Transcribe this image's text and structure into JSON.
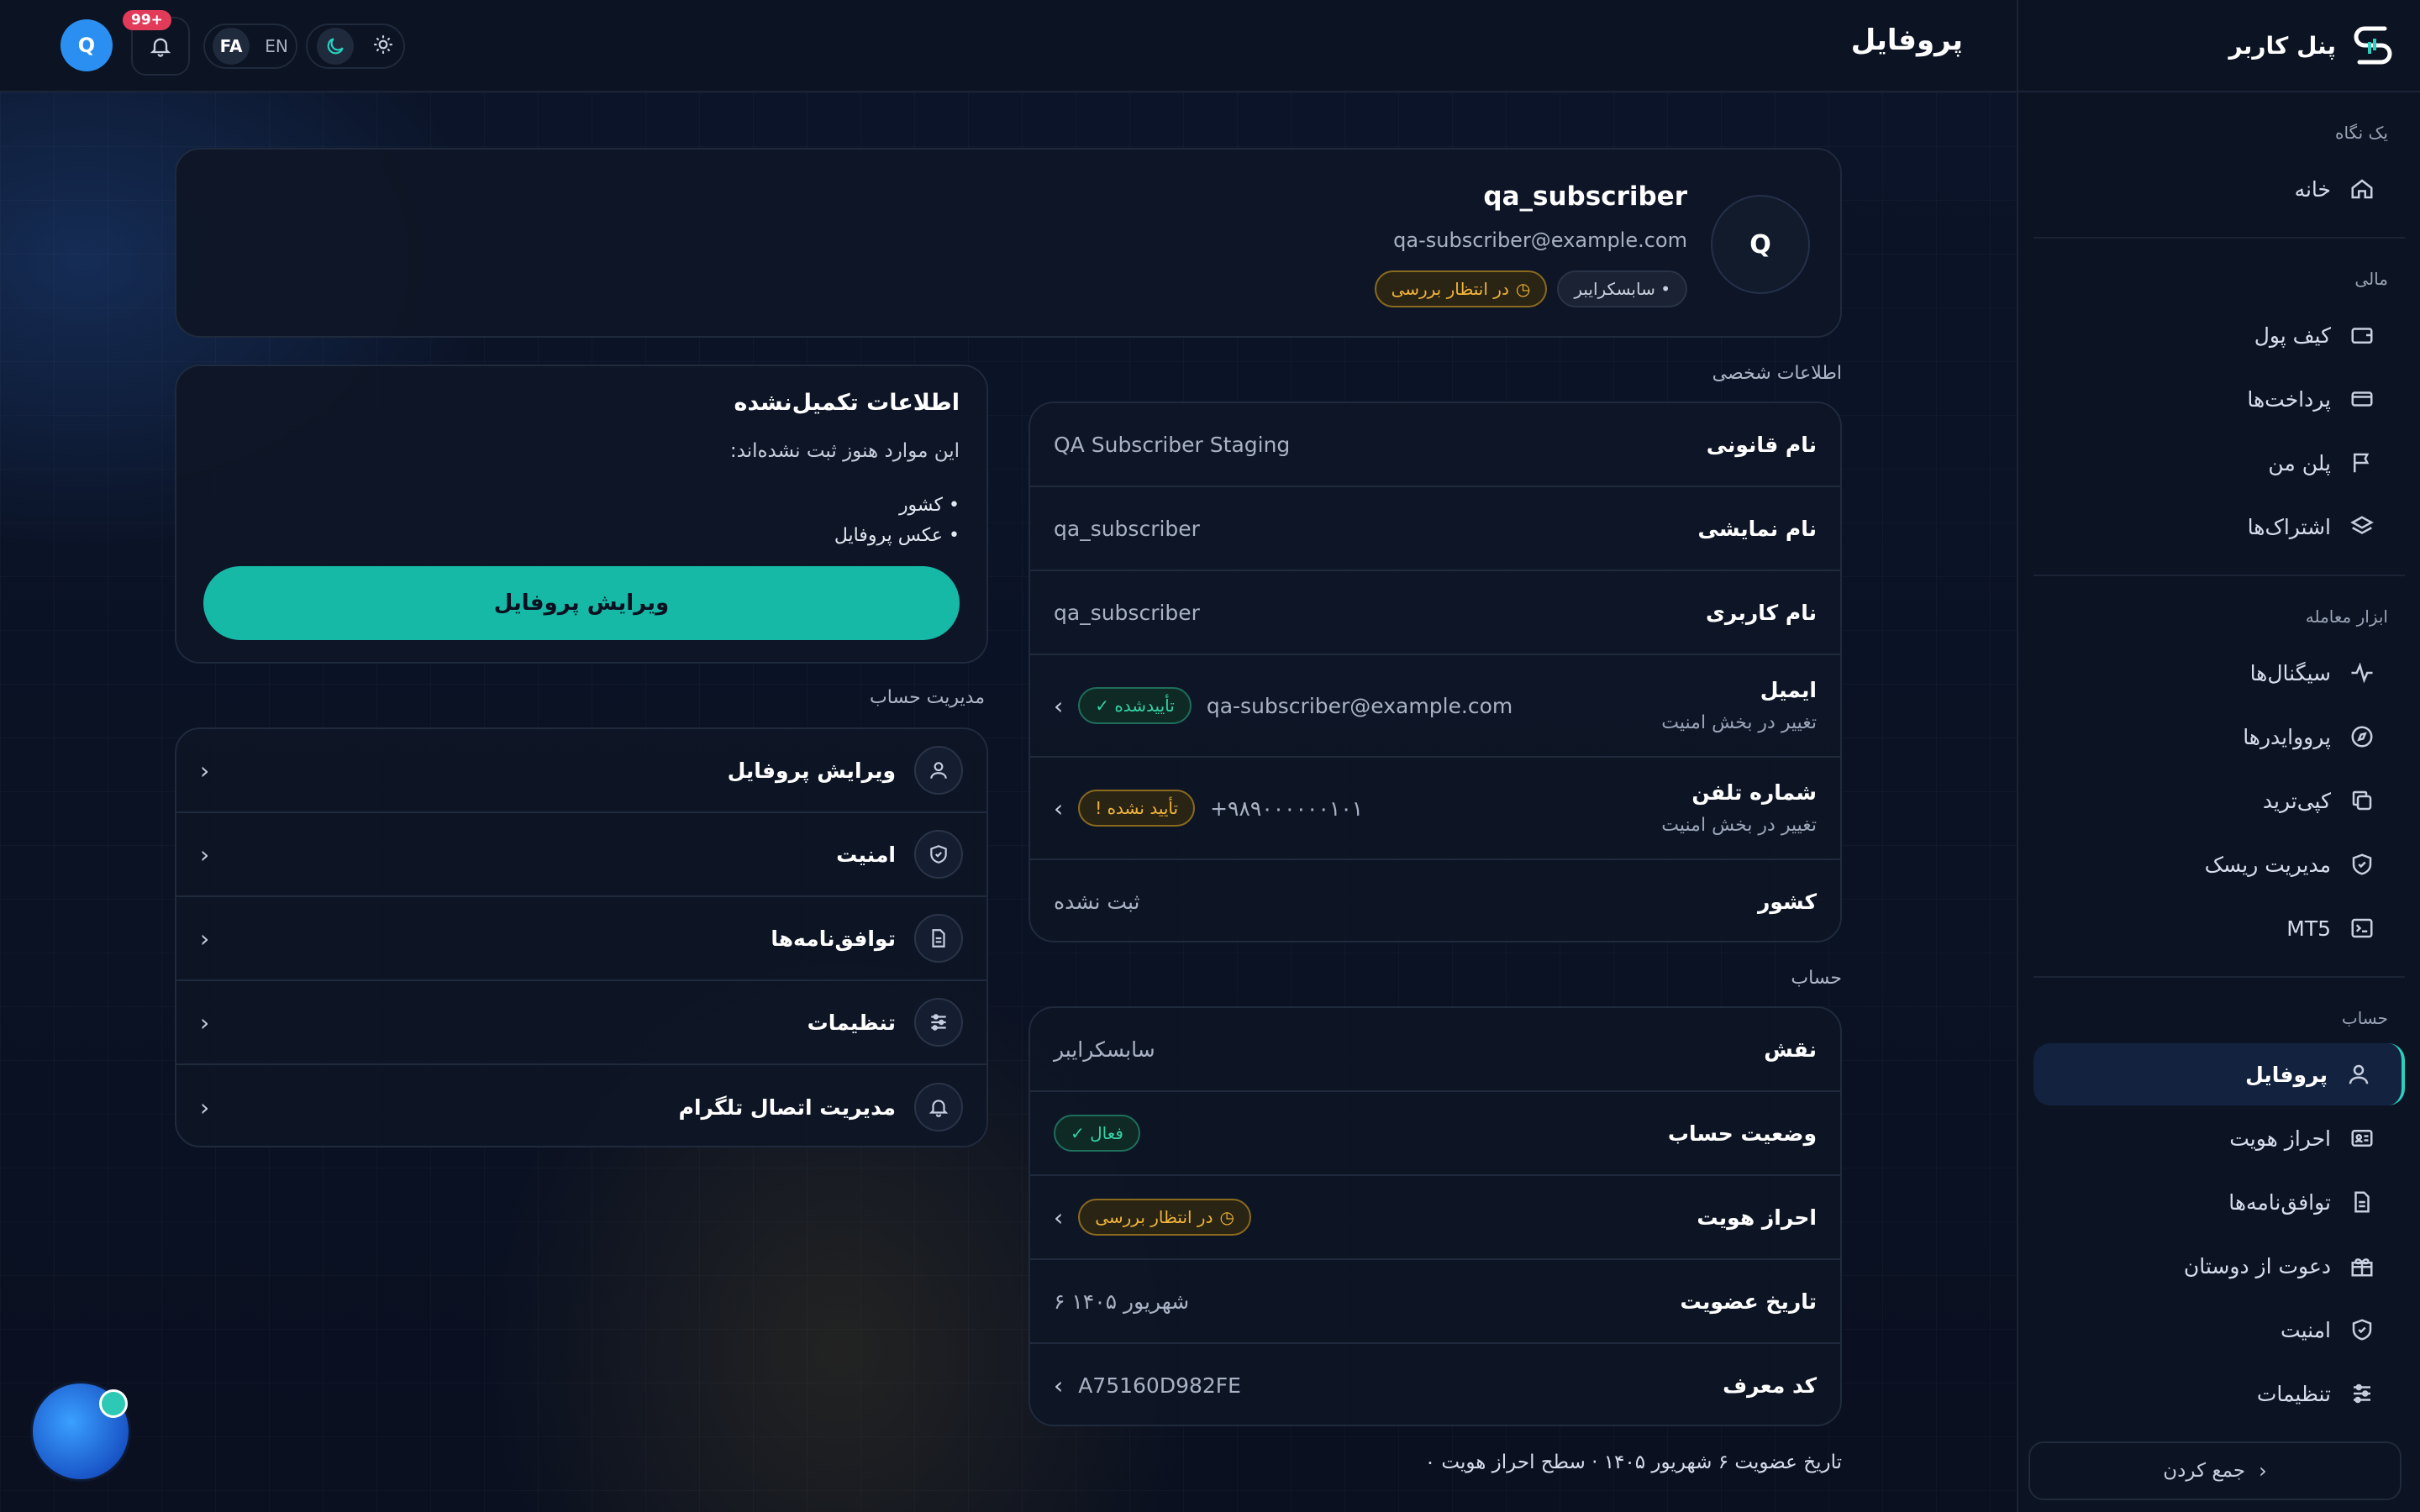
{
  "app": {
    "title": "پنل کاربر",
    "page_title": "پروفایل"
  },
  "topbar": {
    "avatar_initial": "Q",
    "notif_badge": "+99",
    "lang_fa": "FA",
    "lang_en": "EN"
  },
  "sidebar": {
    "sections": [
      {
        "label": "یک نگاه",
        "items": [
          {
            "label": "خانه",
            "icon": "home-icon"
          }
        ]
      },
      {
        "label": "مالی",
        "items": [
          {
            "label": "کیف پول",
            "icon": "wallet-icon"
          },
          {
            "label": "پرداخت‌ها",
            "icon": "card-icon"
          },
          {
            "label": "پلن من",
            "icon": "flag-icon"
          },
          {
            "label": "اشتراک‌ها",
            "icon": "layers-icon"
          }
        ]
      },
      {
        "label": "ابزار معامله",
        "items": [
          {
            "label": "سیگنال‌ها",
            "icon": "pulse-icon"
          },
          {
            "label": "پرووایدرها",
            "icon": "compass-icon"
          },
          {
            "label": "کپی‌ترید",
            "icon": "copy-icon"
          },
          {
            "label": "مدیریت ریسک",
            "icon": "shield-icon"
          },
          {
            "label": "MT5",
            "icon": "terminal-icon"
          }
        ]
      },
      {
        "label": "حساب",
        "items": [
          {
            "label": "پروفایل",
            "icon": "user-icon",
            "active": true
          },
          {
            "label": "احراز هویت",
            "icon": "id-card-icon"
          },
          {
            "label": "توافق‌نامه‌ها",
            "icon": "document-icon"
          },
          {
            "label": "دعوت از دوستان",
            "icon": "gift-icon"
          },
          {
            "label": "امنیت",
            "icon": "shield-icon"
          },
          {
            "label": "تنظیمات",
            "icon": "sliders-icon"
          }
        ]
      }
    ],
    "collapse_label": "جمع کردن"
  },
  "profile": {
    "initial": "Q",
    "username": "qa_subscriber",
    "email": "qa-subscriber@example.com",
    "role_pill": "• سابسکرایبر",
    "status_pill": "در انتظار بررسی"
  },
  "personal": {
    "section_label": "اطلاعات شخصی",
    "legal_name": {
      "k": "نام قانونی",
      "v": "QA Subscriber Staging"
    },
    "display_name": {
      "k": "نام نمایشی",
      "v": "qa_subscriber"
    },
    "user_name": {
      "k": "نام کاربری",
      "v": "qa_subscriber"
    },
    "email": {
      "k": "ایمیل",
      "sub": "تغییر در بخش امنیت",
      "v": "qa-subscriber@example.com",
      "badge": "✓ تأییدشده"
    },
    "phone": {
      "k": "شماره تلفن",
      "sub": "تغییر در بخش امنیت",
      "v": "+۹۸۹۰۰۰۰۰۰۱۰۱",
      "badge": "! تأیید نشده"
    },
    "country": {
      "k": "کشور",
      "v": "ثبت نشده"
    }
  },
  "account": {
    "section_label": "حساب",
    "role": {
      "k": "نقش",
      "v": "سابسکرایبر"
    },
    "status": {
      "k": "وضعیت حساب",
      "badge": "✓ فعال"
    },
    "kyc": {
      "k": "احراز هویت",
      "badge": "در انتظار بررسی"
    },
    "joined": {
      "k": "تاریخ عضویت",
      "v": "۶ شهریور ۱۴۰۵"
    },
    "referral": {
      "k": "کد معرف",
      "v": "A75160D982FE"
    }
  },
  "incomplete": {
    "title": "اطلاعات تکمیل‌نشده",
    "desc": "این موارد هنوز ثبت نشده‌اند:",
    "items": [
      "• کشور",
      "• عکس پروفایل"
    ],
    "button": "ویرایش پروفایل"
  },
  "management": {
    "section_label": "مدیریت حساب",
    "items": [
      {
        "label": "ویرایش پروفایل",
        "icon": "user-icon"
      },
      {
        "label": "امنیت",
        "icon": "shield-icon"
      },
      {
        "label": "توافق‌نامه‌ها",
        "icon": "document-icon"
      },
      {
        "label": "تنظیمات",
        "icon": "sliders-icon"
      },
      {
        "label": "مدیریت اتصال تلگرام",
        "icon": "bell-icon"
      }
    ]
  },
  "footer": "تاریخ عضویت ۶ شهریور ۱۴۰۵ · سطح احراز هویت ۰"
}
